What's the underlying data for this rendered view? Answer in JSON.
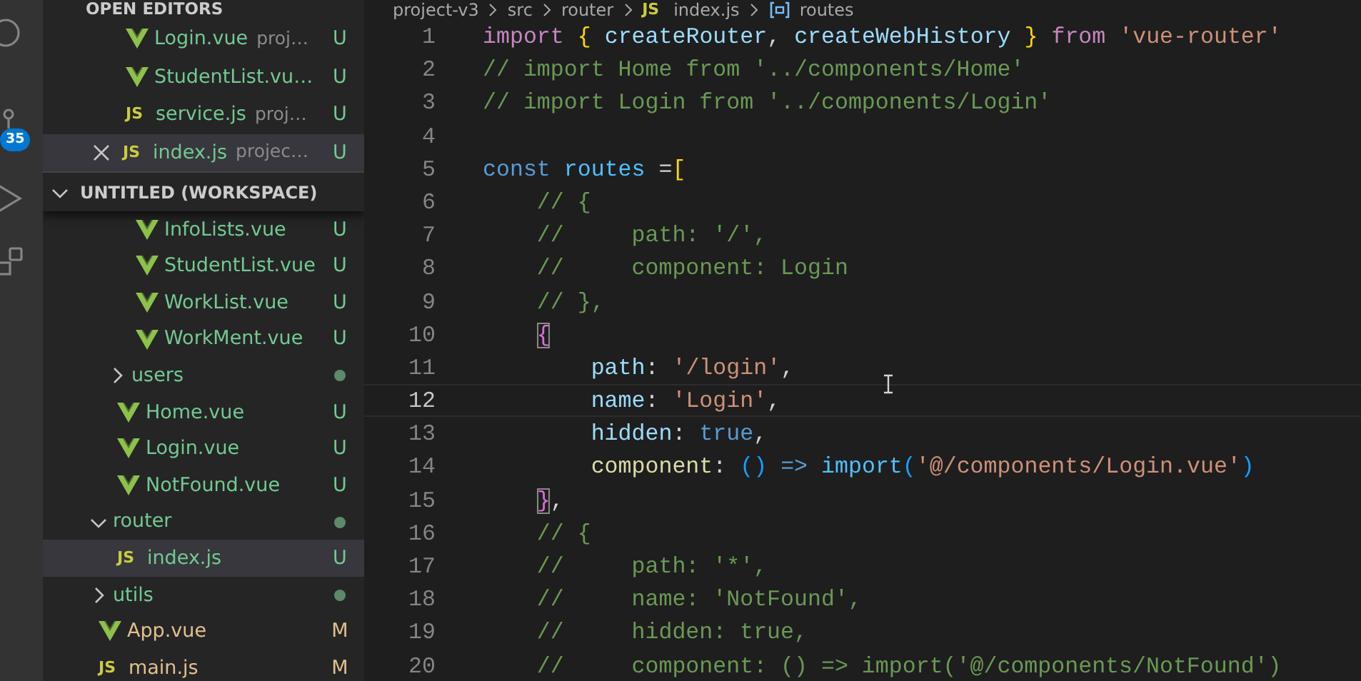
{
  "activity_bar": {
    "source_control_badge": "35"
  },
  "sidebar": {
    "open_editors": {
      "title": "OPEN EDITORS",
      "items": [
        {
          "name": "Login.vue",
          "description": "proj…",
          "status": "U",
          "color": "#73c991",
          "kind": "vue",
          "selected": false,
          "close": false
        },
        {
          "name": "StudentList.vu…",
          "status": "U",
          "color": "#73c991",
          "kind": "vue",
          "selected": false,
          "close": false
        },
        {
          "name": "service.js",
          "description": "proj…",
          "status": "U",
          "color": "#73c991",
          "kind": "js",
          "icon_text": "JS",
          "selected": false,
          "close": false
        },
        {
          "name": "index.js",
          "description": "projec…",
          "status": "U",
          "color": "#73c991",
          "kind": "js",
          "icon_text": "JS",
          "selected": true,
          "close": true
        }
      ]
    },
    "workspace": {
      "title": "UNTITLED (WORKSPACE)",
      "expanded": true,
      "tree": [
        {
          "children": [
            {
              "children": [
                {
                  "name": "InfoLists.vue",
                  "kind": "vue",
                  "status": "U",
                  "color": "#73c991",
                  "selected": false
                },
                {
                  "name": "StudentList.vue",
                  "kind": "vue",
                  "status": "U",
                  "color": "#73c991",
                  "selected": false
                },
                {
                  "name": "WorkList.vue",
                  "kind": "vue",
                  "status": "U",
                  "color": "#73c991",
                  "selected": false
                },
                {
                  "name": "WorkMent.vue",
                  "kind": "vue",
                  "status": "U",
                  "color": "#73c991",
                  "selected": false
                }
              ]
            },
            {
              "name": "users",
              "kind": "folder",
              "expanded": false,
              "color": "#73c991",
              "has_changes": true,
              "selected": false
            },
            {
              "name": "Home.vue",
              "kind": "vue",
              "status": "U",
              "color": "#73c991",
              "selected": false
            },
            {
              "name": "Login.vue",
              "kind": "vue",
              "status": "U",
              "color": "#73c991",
              "selected": false
            },
            {
              "name": "NotFound.vue",
              "kind": "vue",
              "status": "U",
              "color": "#73c991",
              "selected": false
            }
          ]
        },
        {
          "name": "router",
          "kind": "folder",
          "expanded": true,
          "color": "#73c991",
          "has_changes": true,
          "selected": false,
          "children": [
            {
              "name": "index.js",
              "kind": "js",
              "icon_text": "JS",
              "status": "U",
              "color": "#73c991",
              "selected": true
            }
          ]
        },
        {
          "name": "utils",
          "kind": "folder",
          "expanded": false,
          "color": "#73c991",
          "has_changes": true,
          "selected": false
        },
        {
          "name": "App.vue",
          "kind": "vue",
          "status": "M",
          "color": "#e2c08d",
          "selected": false
        },
        {
          "name": "main.js",
          "kind": "js",
          "icon_text": "JS",
          "status": "M",
          "color": "#e2c08d",
          "selected": false
        }
      ]
    }
  },
  "editor": {
    "breadcrumb": [
      {
        "text": "project-v3"
      },
      {
        "text": "src"
      },
      {
        "text": "router"
      },
      {
        "text": "index.js",
        "kind": "js",
        "icon_text": "JS"
      },
      {
        "text": "routes",
        "kind": "symbol"
      }
    ],
    "lines": [
      {
        "number": "1",
        "current": false,
        "tokens": [
          {
            "kind": "keyword",
            "text": "import"
          },
          {
            "kind": "bracket1",
            "text": " {"
          },
          {
            "kind": "variable",
            "text": " createRouter"
          },
          {
            "kind": "plain",
            "text": ", "
          },
          {
            "kind": "variable",
            "text": "createWebHistory"
          },
          {
            "kind": "bracket1",
            "text": " }"
          },
          {
            "kind": "keyword",
            "text": " from"
          },
          {
            "kind": "string",
            "text": " 'vue-router'"
          }
        ]
      },
      {
        "number": "2",
        "current": false,
        "tokens": [
          {
            "kind": "comment",
            "text": "// import Home from '../components/Home'"
          }
        ]
      },
      {
        "number": "3",
        "current": false,
        "tokens": [
          {
            "kind": "comment",
            "text": "// import Login from '../components/Login'"
          }
        ]
      },
      {
        "number": "4",
        "current": false
      },
      {
        "number": "5",
        "current": false,
        "tokens": [
          {
            "kind": "storage",
            "text": "const"
          },
          {
            "kind": "constant",
            "text": " routes"
          },
          {
            "kind": "plain",
            "text": " ="
          },
          {
            "kind": "bracket1",
            "text": "["
          }
        ],
        "children": [
          {
            "number": "6",
            "current": false,
            "tokens": [
              {
                "kind": "comment",
                "text": "// {"
              }
            ]
          },
          {
            "number": "7",
            "current": false,
            "tokens": [
              {
                "kind": "comment",
                "text": "//     path: '/',"
              }
            ]
          },
          {
            "number": "8",
            "current": false,
            "tokens": [
              {
                "kind": "comment",
                "text": "//     component: Login"
              }
            ]
          },
          {
            "number": "9",
            "current": false,
            "tokens": [
              {
                "kind": "comment",
                "text": "// },"
              }
            ]
          },
          {
            "number": "10",
            "current": false,
            "tokens": [
              {
                "kind": "bracket2",
                "text": "{",
                "matched": true
              }
            ],
            "children": [
              {
                "number": "11",
                "current": false,
                "tokens": [
                  {
                    "kind": "variable",
                    "text": "path"
                  },
                  {
                    "kind": "plain",
                    "text": ": "
                  },
                  {
                    "kind": "string",
                    "text": "'/login'"
                  },
                  {
                    "kind": "plain",
                    "text": ","
                  }
                ]
              },
              {
                "number": "12",
                "current": true,
                "tokens": [
                  {
                    "kind": "variable",
                    "text": "name"
                  },
                  {
                    "kind": "plain",
                    "text": ": "
                  },
                  {
                    "kind": "string",
                    "text": "'Login'"
                  },
                  {
                    "kind": "plain",
                    "text": ","
                  }
                ]
              },
              {
                "number": "13",
                "current": false,
                "tokens": [
                  {
                    "kind": "variable",
                    "text": "hidden"
                  },
                  {
                    "kind": "plain",
                    "text": ": "
                  },
                  {
                    "kind": "storage",
                    "text": "true"
                  },
                  {
                    "kind": "plain",
                    "text": ","
                  }
                ]
              },
              {
                "number": "14",
                "current": false,
                "tokens": [
                  {
                    "kind": "function",
                    "text": "component"
                  },
                  {
                    "kind": "plain",
                    "text": ": "
                  },
                  {
                    "kind": "bracket3",
                    "text": "()"
                  },
                  {
                    "kind": "storage",
                    "text": " =>"
                  },
                  {
                    "kind": "constant",
                    "text": " import"
                  },
                  {
                    "kind": "bracket3",
                    "text": "("
                  },
                  {
                    "kind": "string",
                    "text": "'@/components/Login.vue'"
                  },
                  {
                    "kind": "bracket3",
                    "text": ")"
                  }
                ]
              }
            ]
          },
          {
            "number": "15",
            "current": false,
            "tokens": [
              {
                "kind": "bracket2",
                "text": "}",
                "matched": true
              },
              {
                "kind": "plain",
                "text": ","
              }
            ]
          },
          {
            "number": "16",
            "current": false,
            "tokens": [
              {
                "kind": "comment",
                "text": "// {"
              }
            ]
          },
          {
            "number": "17",
            "current": false,
            "tokens": [
              {
                "kind": "comment",
                "text": "//     path: '*',"
              }
            ]
          },
          {
            "number": "18",
            "current": false,
            "tokens": [
              {
                "kind": "comment",
                "text": "//     name: 'NotFound',"
              }
            ]
          },
          {
            "number": "19",
            "current": false,
            "tokens": [
              {
                "kind": "comment",
                "text": "//     hidden: true,"
              }
            ]
          },
          {
            "number": "20",
            "current": false,
            "tokens": [
              {
                "kind": "comment",
                "text": "//     component: () => import('@/components/NotFound')"
              }
            ]
          }
        ]
      }
    ]
  }
}
